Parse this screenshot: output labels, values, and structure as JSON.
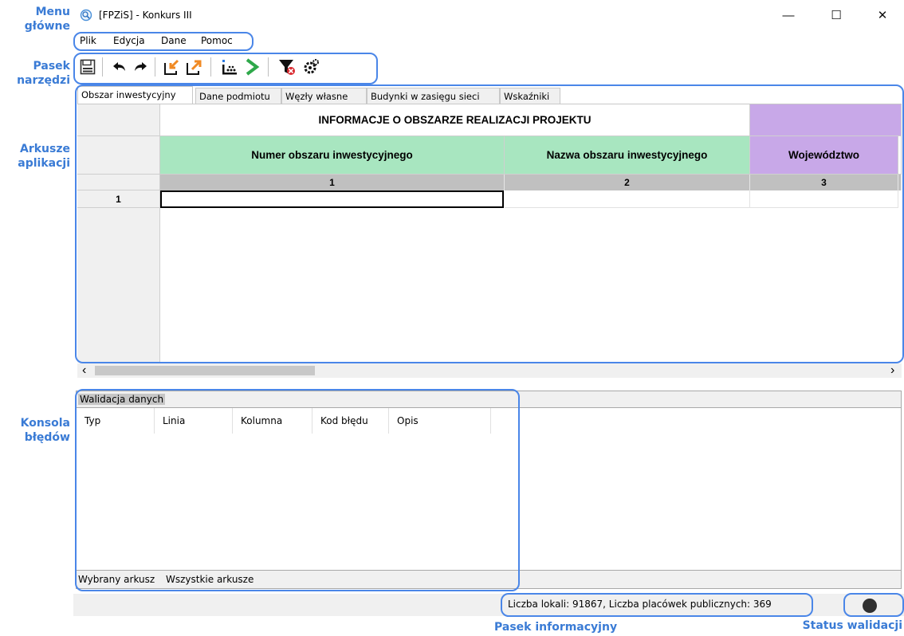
{
  "annotations": {
    "menu": "Menu\ngłówne",
    "toolbar": "Pasek\nnarzędzi",
    "sheets": "Arkusze\naplikacji",
    "console": "Konsola\nbłędów",
    "infobar": "Pasek informacyjny",
    "validation_status": "Status walidacji"
  },
  "window": {
    "title": "[FPZiS] - Konkurs III",
    "minimize": "—",
    "maximize": "☐",
    "close": "✕"
  },
  "menu": {
    "items": [
      "Plik",
      "Edycja",
      "Dane",
      "Pomoc"
    ]
  },
  "toolbar": {
    "icons": [
      "save-icon",
      "undo-icon",
      "redo-icon",
      "import-icon",
      "export-icon",
      "chart-icon",
      "run-icon",
      "filter-clear-icon",
      "settings-icon"
    ]
  },
  "tabs": {
    "items": [
      "Obszar inwestycyjny",
      "Dane podmiotu",
      "Węzły własne",
      "Budynki w zasięgu sieci",
      "Wskaźniki"
    ],
    "active": 0
  },
  "grid": {
    "section_title": "INFORMACJE O OBSZARZE REALIZACJI PROJEKTU",
    "columns": [
      {
        "title": "Numer obszaru inwestycyjnego",
        "number": "1",
        "color": "#a8e6c0"
      },
      {
        "title": "Nazwa obszaru inwestycyjnego",
        "number": "2",
        "color": "#a8e6c0"
      },
      {
        "title": "Województwo",
        "number": "3",
        "color": "#c8a8e8"
      }
    ],
    "rows": [
      {
        "number": "1",
        "cells": [
          "",
          "",
          ""
        ]
      }
    ]
  },
  "scrollbar": {
    "left": "‹",
    "right": "›"
  },
  "console": {
    "title": "Walidacja danych",
    "columns": [
      "Typ",
      "Linia",
      "Kolumna",
      "Kod błędu",
      "Opis"
    ],
    "tabs": [
      "Wybrany arkusz",
      "Wszystkie arkusze"
    ]
  },
  "statusbar": {
    "info": "Liczba lokali: 91867, Liczba placówek publicznych: 369",
    "validation_color": "#303030"
  }
}
